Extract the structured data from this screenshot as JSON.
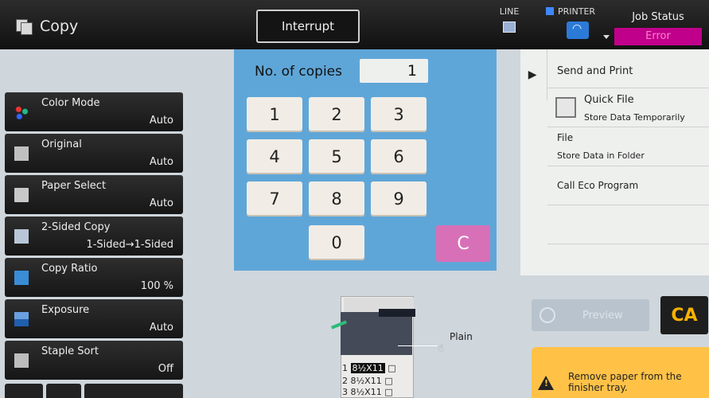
{
  "header": {
    "app_title": "Copy",
    "interrupt_label": "Interrupt",
    "line_label": "LINE",
    "printer_label": "PRINTER",
    "job_status_label": "Job Status",
    "job_status_value": "Error"
  },
  "sidebar": {
    "items": [
      {
        "label": "Color Mode",
        "value": "Auto",
        "icon": "color-mode-icon"
      },
      {
        "label": "Original",
        "value": "Auto",
        "icon": "original-icon"
      },
      {
        "label": "Paper Select",
        "value": "Auto",
        "icon": "paper-icon"
      },
      {
        "label": "2-Sided Copy",
        "value": "1-Sided→1-Sided",
        "icon": "two-sided-icon"
      },
      {
        "label": "Copy Ratio",
        "value": "100 %",
        "icon": "copy-ratio-icon"
      },
      {
        "label": "Exposure",
        "value": "Auto",
        "icon": "exposure-icon"
      },
      {
        "label": "Staple Sort",
        "value": "Off",
        "icon": "staple-icon"
      }
    ]
  },
  "keypad": {
    "copies_label": "No. of copies",
    "copies_value": "1",
    "keys": [
      "1",
      "2",
      "3",
      "4",
      "5",
      "6",
      "7",
      "8",
      "9",
      "0"
    ],
    "clear_label": "C"
  },
  "right_panel": {
    "send_and_print": "Send and Print",
    "quick_file_title": "Quick File",
    "quick_file_sub": "Store Data Temporarily",
    "file_title": "File",
    "file_sub": "Store Data in Folder",
    "eco_program": "Call Eco Program"
  },
  "tray": {
    "rows": [
      {
        "num": "1",
        "size": "8½X11"
      },
      {
        "num": "2",
        "size": "8½X11"
      },
      {
        "num": "3",
        "size": "8½X11"
      }
    ],
    "paper_type": "Plain"
  },
  "preview_label": "Preview",
  "ca_label": "CA",
  "warning_text": "Remove paper from the finisher tray.",
  "colors": {
    "keypad_bg": "#5fa6d8",
    "clear_key": "#d870b8",
    "error_badge": "#c0008a",
    "warning_bg": "#ffc247",
    "ca_text": "#f7b200"
  }
}
